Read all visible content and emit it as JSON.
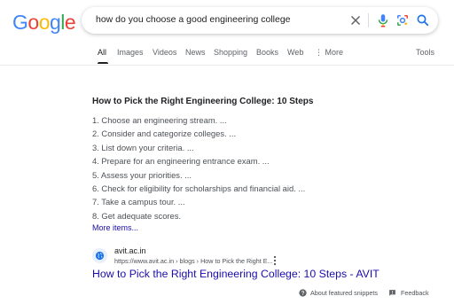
{
  "logo": {
    "text": "Google",
    "letters": [
      "G",
      "o",
      "o",
      "g",
      "l",
      "e"
    ],
    "colors": [
      "#4285f4",
      "#ea4335",
      "#fbbc05",
      "#4285f4",
      "#34a853",
      "#ea4335"
    ]
  },
  "search": {
    "query": "how do you choose a good engineering college"
  },
  "tabs": [
    {
      "label": "All",
      "active": true
    },
    {
      "label": "Images"
    },
    {
      "label": "Videos"
    },
    {
      "label": "News"
    },
    {
      "label": "Shopping"
    },
    {
      "label": "Books"
    },
    {
      "label": "Web"
    },
    {
      "label": "More"
    }
  ],
  "tools_label": "Tools",
  "snippet": {
    "title": "How to Pick the Right Engineering College: 10 Steps",
    "steps": [
      "1. Choose an engineering stream. ...",
      "2. Consider and categorize colleges. ...",
      "3. List down your criteria. ...",
      "4. Prepare for an engineering entrance exam. ...",
      "5. Assess your priorities. ...",
      "6. Check for eligibility for scholarships and financial aid. ...",
      "7. Take a campus tour. ...",
      "8. Get adequate scores."
    ],
    "more_items": "More items...",
    "site_name": "avit.ac.in",
    "site_url": "https://www.avit.ac.in › blogs › How to Pick the Right E...",
    "result_title": "How to Pick the Right Engineering College: 10 Steps - AVIT"
  },
  "footer": {
    "about": "About featured snippets",
    "feedback": "Feedback"
  },
  "colors": {
    "link": "#1a0dab",
    "accent": "#1a73e8"
  }
}
